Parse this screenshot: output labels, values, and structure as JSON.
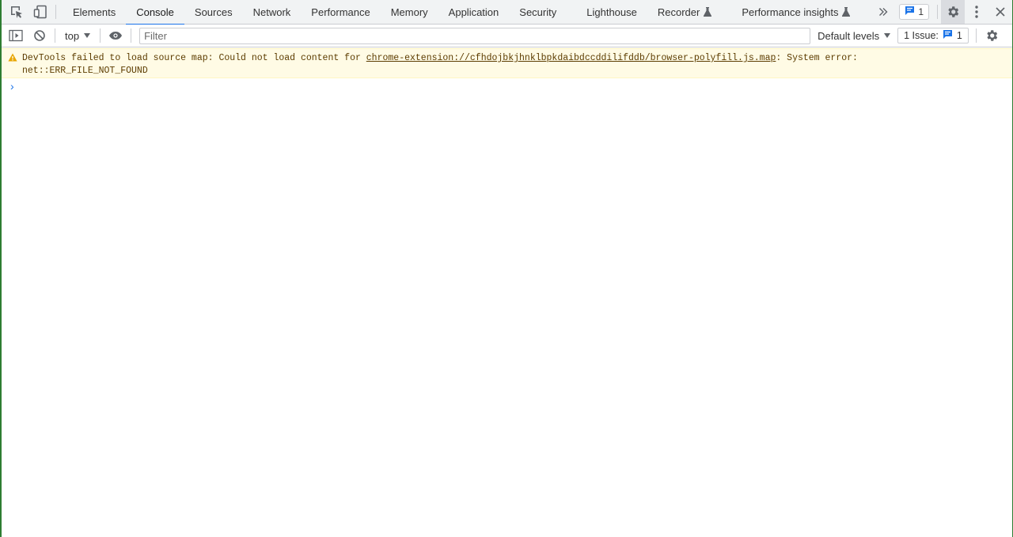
{
  "tabs": {
    "items": [
      {
        "label": "Elements"
      },
      {
        "label": "Console"
      },
      {
        "label": "Sources"
      },
      {
        "label": "Network"
      },
      {
        "label": "Performance"
      },
      {
        "label": "Memory"
      },
      {
        "label": "Application"
      },
      {
        "label": "Security"
      },
      {
        "label": "Lighthouse"
      },
      {
        "label": "Recorder"
      },
      {
        "label": "Performance insights"
      }
    ],
    "active": "Console",
    "messages_count": "1"
  },
  "toolbar": {
    "context": "top",
    "filter_placeholder": "Filter",
    "levels_label": "Default levels",
    "issues_label": "1 Issue:",
    "issues_count": "1"
  },
  "console": {
    "warning": {
      "prefix": "DevTools failed to load source map: Could not load content for ",
      "link": "chrome-extension://cfhdojbkjhnklbpkdaibdccddilifddb/browser-polyfill.js.map",
      "suffix": ": System error:",
      "line2": "net::ERR_FILE_NOT_FOUND"
    },
    "prompt_symbol": "›"
  },
  "colors": {
    "accent": "#1a73e8",
    "warning_bg": "#fffbe5",
    "warning_text": "#5c3c00",
    "warning_icon": "#e8a600"
  }
}
